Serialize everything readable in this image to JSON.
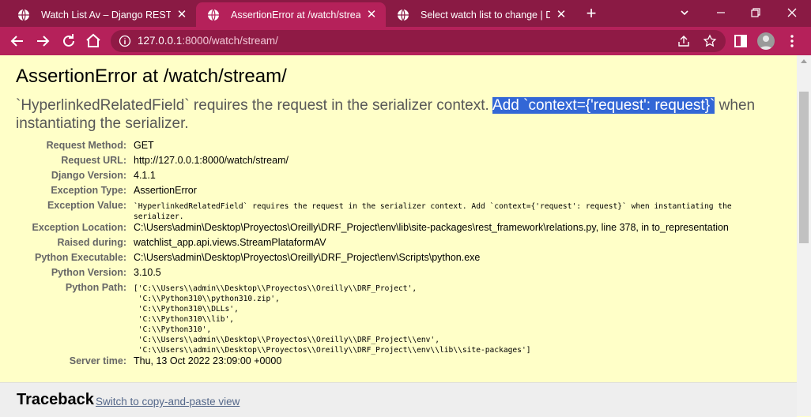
{
  "browser": {
    "tabs": [
      {
        "title": "Watch List Av – Django REST framework",
        "active": false
      },
      {
        "title": "AssertionError at /watch/stream/",
        "active": true
      },
      {
        "title": "Select watch list to change | Django site admin",
        "active": false
      }
    ],
    "url_host": "127.0.0.1",
    "url_rest": ":8000/watch/stream/",
    "icons": {
      "back": "back-arrow-icon",
      "forward": "forward-arrow-icon",
      "reload": "reload-icon",
      "home": "home-icon",
      "info": "info-icon",
      "share": "share-icon",
      "bookmark": "star-icon",
      "sidepanel": "side-panel-icon",
      "menu": "kebab-menu-icon"
    },
    "colors": {
      "tabstrip": "#8a1a44",
      "active_tab": "#b5215a",
      "toolbar": "#b5215a"
    }
  },
  "error": {
    "heading": "AssertionError at /watch/stream/",
    "message_pre": "`HyperlinkedRelatedField` requires the request in the serializer context. ",
    "message_highlight": "Add `context={'request': request}`",
    "message_post": " when instantiating the serializer."
  },
  "meta": [
    {
      "label": "Request Method:",
      "value": "GET"
    },
    {
      "label": "Request URL:",
      "value": "http://127.0.0.1:8000/watch/stream/"
    },
    {
      "label": "Django Version:",
      "value": "4.1.1"
    },
    {
      "label": "Exception Type:",
      "value": "AssertionError"
    },
    {
      "label": "Exception Value:",
      "value": "`HyperlinkedRelatedField` requires the request in the serializer context. Add `context={'request': request}` when instantiating the\nserializer."
    },
    {
      "label": "Exception Location:",
      "value": "C:\\Users\\admin\\Desktop\\Proyectos\\Oreilly\\DRF_Project\\env\\lib\\site-packages\\rest_framework\\relations.py, line 378, in to_representation"
    },
    {
      "label": "Raised during:",
      "value": "watchlist_app.api.views.StreamPlataformAV"
    },
    {
      "label": "Python Executable:",
      "value": "C:\\Users\\admin\\Desktop\\Proyectos\\Oreilly\\DRF_Project\\env\\Scripts\\python.exe"
    },
    {
      "label": "Python Version:",
      "value": "3.10.5"
    },
    {
      "label": "Python Path:",
      "value": "['C:\\\\Users\\\\admin\\\\Desktop\\\\Proyectos\\\\Oreilly\\\\DRF_Project',\n 'C:\\\\Python310\\\\python310.zip',\n 'C:\\\\Python310\\\\DLLs',\n 'C:\\\\Python310\\\\lib',\n 'C:\\\\Python310',\n 'C:\\\\Users\\\\admin\\\\Desktop\\\\Proyectos\\\\Oreilly\\\\DRF_Project\\\\env',\n 'C:\\\\Users\\\\admin\\\\Desktop\\\\Proyectos\\\\Oreilly\\\\DRF_Project\\\\env\\\\lib\\\\site-packages']"
    },
    {
      "label": "Server time:",
      "value": "Thu, 13 Oct 2022 23:09:00 +0000"
    }
  ],
  "traceback": {
    "heading": "Traceback",
    "switch_link": "Switch to copy-and-paste view"
  }
}
